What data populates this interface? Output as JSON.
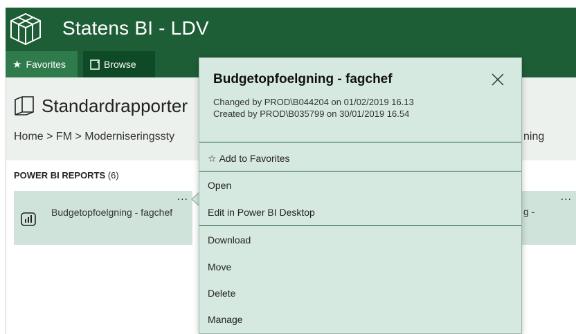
{
  "app": {
    "title": "Statens BI - LDV"
  },
  "nav": {
    "tabs": [
      {
        "label": "Favorites",
        "icon": "star-icon"
      },
      {
        "label": "Browse",
        "icon": "page-icon"
      }
    ]
  },
  "page": {
    "title": "Standardrapporter",
    "breadcrumb": "Home > FM > Moderniseringssty",
    "breadcrumb_tail": "ning",
    "section": {
      "label": "POWER BI REPORTS",
      "count": "(6)"
    },
    "tiles": [
      {
        "name": "Budgetopfoelgning - fagchef",
        "more": "..."
      },
      {
        "name": "g -",
        "more": "..."
      }
    ]
  },
  "popup": {
    "title": "Budgetopfoelgning - fagchef",
    "changed": "Changed by PROD\\B044204 on 01/02/2019 16.13",
    "created": "Created by PROD\\B035799 on 30/01/2019 16.54",
    "menu": {
      "add_favorites": "Add to Favorites",
      "open": "Open",
      "edit": "Edit in Power BI Desktop",
      "download": "Download",
      "move": "Move",
      "delete": "Delete",
      "manage": "Manage"
    }
  },
  "colors": {
    "brand": "#1e5e36",
    "tile": "#cfe3da",
    "popup": "#d6e9e1"
  }
}
